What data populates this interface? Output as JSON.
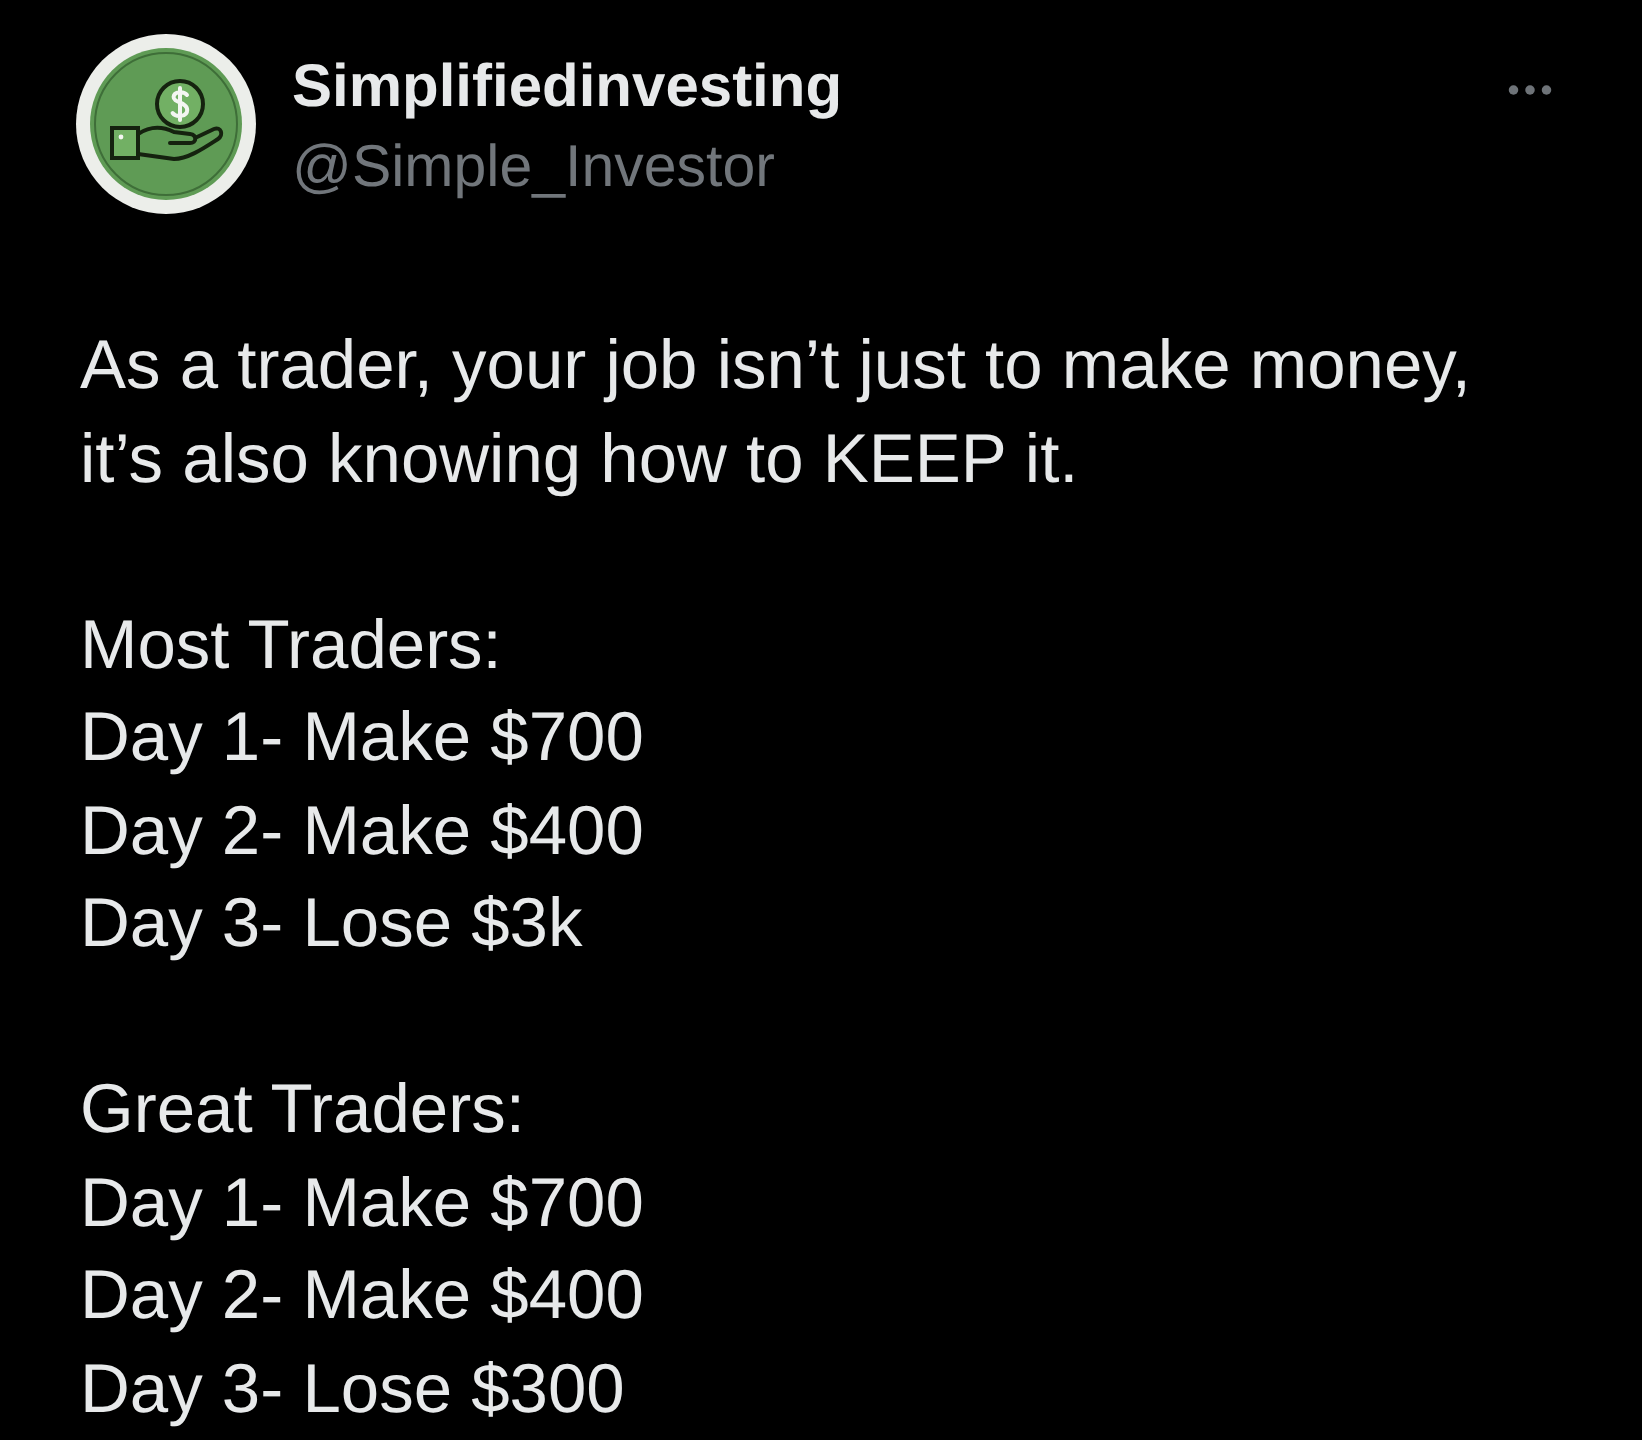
{
  "author": {
    "name": "Simplifiedinvesting",
    "handle": "@Simple_Investor"
  },
  "body": [
    {
      "kind": "paragraph",
      "lines": [
        "As a trader, your job isn’t just to make money,",
        "it’s also knowing how to KEEP it."
      ]
    },
    {
      "kind": "list",
      "heading": "Most Traders:",
      "items": [
        "Day 1- Make $700",
        "Day 2- Make $400",
        "Day 3- Lose $3k"
      ]
    },
    {
      "kind": "list",
      "heading": "Great Traders:",
      "items": [
        "Day 1- Make $700",
        "Day 2- Make $400",
        "Day 3- Lose $300"
      ]
    }
  ]
}
